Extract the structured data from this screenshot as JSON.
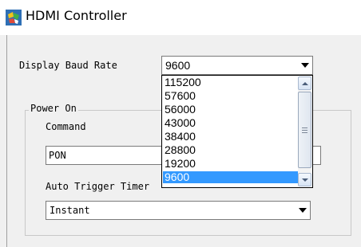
{
  "window": {
    "title": "HDMI Controller",
    "icon": "hdmi-app-icon"
  },
  "baud": {
    "label": "Display Baud Rate",
    "selected": "9600",
    "options": [
      "115200",
      "57600",
      "56000",
      "43000",
      "38400",
      "28800",
      "19200",
      "9600"
    ],
    "highlighted_index": 7
  },
  "power_on": {
    "group_title": "Power On",
    "command_label": "Command",
    "command_value": "PON",
    "trigger_label": "Auto Trigger Timer",
    "trigger_value": "Instant"
  },
  "colors": {
    "selection": "#3399ff",
    "window_bg": "#f0f0f0"
  }
}
